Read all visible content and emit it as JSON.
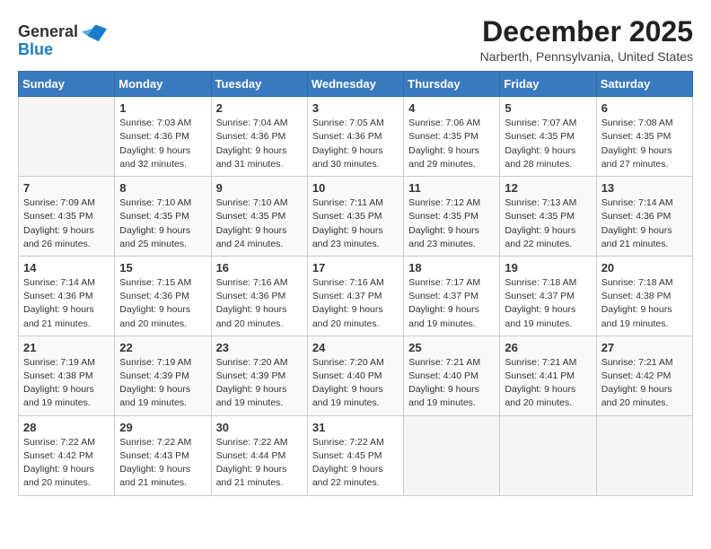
{
  "logo": {
    "line1": "General",
    "line2": "Blue"
  },
  "title": "December 2025",
  "subtitle": "Narberth, Pennsylvania, United States",
  "days_header": [
    "Sunday",
    "Monday",
    "Tuesday",
    "Wednesday",
    "Thursday",
    "Friday",
    "Saturday"
  ],
  "weeks": [
    [
      {
        "date": "",
        "info": ""
      },
      {
        "date": "1",
        "info": "Sunrise: 7:03 AM\nSunset: 4:36 PM\nDaylight: 9 hours\nand 32 minutes."
      },
      {
        "date": "2",
        "info": "Sunrise: 7:04 AM\nSunset: 4:36 PM\nDaylight: 9 hours\nand 31 minutes."
      },
      {
        "date": "3",
        "info": "Sunrise: 7:05 AM\nSunset: 4:36 PM\nDaylight: 9 hours\nand 30 minutes."
      },
      {
        "date": "4",
        "info": "Sunrise: 7:06 AM\nSunset: 4:35 PM\nDaylight: 9 hours\nand 29 minutes."
      },
      {
        "date": "5",
        "info": "Sunrise: 7:07 AM\nSunset: 4:35 PM\nDaylight: 9 hours\nand 28 minutes."
      },
      {
        "date": "6",
        "info": "Sunrise: 7:08 AM\nSunset: 4:35 PM\nDaylight: 9 hours\nand 27 minutes."
      }
    ],
    [
      {
        "date": "7",
        "info": "Sunrise: 7:09 AM\nSunset: 4:35 PM\nDaylight: 9 hours\nand 26 minutes."
      },
      {
        "date": "8",
        "info": "Sunrise: 7:10 AM\nSunset: 4:35 PM\nDaylight: 9 hours\nand 25 minutes."
      },
      {
        "date": "9",
        "info": "Sunrise: 7:10 AM\nSunset: 4:35 PM\nDaylight: 9 hours\nand 24 minutes."
      },
      {
        "date": "10",
        "info": "Sunrise: 7:11 AM\nSunset: 4:35 PM\nDaylight: 9 hours\nand 23 minutes."
      },
      {
        "date": "11",
        "info": "Sunrise: 7:12 AM\nSunset: 4:35 PM\nDaylight: 9 hours\nand 23 minutes."
      },
      {
        "date": "12",
        "info": "Sunrise: 7:13 AM\nSunset: 4:35 PM\nDaylight: 9 hours\nand 22 minutes."
      },
      {
        "date": "13",
        "info": "Sunrise: 7:14 AM\nSunset: 4:36 PM\nDaylight: 9 hours\nand 21 minutes."
      }
    ],
    [
      {
        "date": "14",
        "info": "Sunrise: 7:14 AM\nSunset: 4:36 PM\nDaylight: 9 hours\nand 21 minutes."
      },
      {
        "date": "15",
        "info": "Sunrise: 7:15 AM\nSunset: 4:36 PM\nDaylight: 9 hours\nand 20 minutes."
      },
      {
        "date": "16",
        "info": "Sunrise: 7:16 AM\nSunset: 4:36 PM\nDaylight: 9 hours\nand 20 minutes."
      },
      {
        "date": "17",
        "info": "Sunrise: 7:16 AM\nSunset: 4:37 PM\nDaylight: 9 hours\nand 20 minutes."
      },
      {
        "date": "18",
        "info": "Sunrise: 7:17 AM\nSunset: 4:37 PM\nDaylight: 9 hours\nand 19 minutes."
      },
      {
        "date": "19",
        "info": "Sunrise: 7:18 AM\nSunset: 4:37 PM\nDaylight: 9 hours\nand 19 minutes."
      },
      {
        "date": "20",
        "info": "Sunrise: 7:18 AM\nSunset: 4:38 PM\nDaylight: 9 hours\nand 19 minutes."
      }
    ],
    [
      {
        "date": "21",
        "info": "Sunrise: 7:19 AM\nSunset: 4:38 PM\nDaylight: 9 hours\nand 19 minutes."
      },
      {
        "date": "22",
        "info": "Sunrise: 7:19 AM\nSunset: 4:39 PM\nDaylight: 9 hours\nand 19 minutes."
      },
      {
        "date": "23",
        "info": "Sunrise: 7:20 AM\nSunset: 4:39 PM\nDaylight: 9 hours\nand 19 minutes."
      },
      {
        "date": "24",
        "info": "Sunrise: 7:20 AM\nSunset: 4:40 PM\nDaylight: 9 hours\nand 19 minutes."
      },
      {
        "date": "25",
        "info": "Sunrise: 7:21 AM\nSunset: 4:40 PM\nDaylight: 9 hours\nand 19 minutes."
      },
      {
        "date": "26",
        "info": "Sunrise: 7:21 AM\nSunset: 4:41 PM\nDaylight: 9 hours\nand 20 minutes."
      },
      {
        "date": "27",
        "info": "Sunrise: 7:21 AM\nSunset: 4:42 PM\nDaylight: 9 hours\nand 20 minutes."
      }
    ],
    [
      {
        "date": "28",
        "info": "Sunrise: 7:22 AM\nSunset: 4:42 PM\nDaylight: 9 hours\nand 20 minutes."
      },
      {
        "date": "29",
        "info": "Sunrise: 7:22 AM\nSunset: 4:43 PM\nDaylight: 9 hours\nand 21 minutes."
      },
      {
        "date": "30",
        "info": "Sunrise: 7:22 AM\nSunset: 4:44 PM\nDaylight: 9 hours\nand 21 minutes."
      },
      {
        "date": "31",
        "info": "Sunrise: 7:22 AM\nSunset: 4:45 PM\nDaylight: 9 hours\nand 22 minutes."
      },
      {
        "date": "",
        "info": ""
      },
      {
        "date": "",
        "info": ""
      },
      {
        "date": "",
        "info": ""
      }
    ]
  ]
}
